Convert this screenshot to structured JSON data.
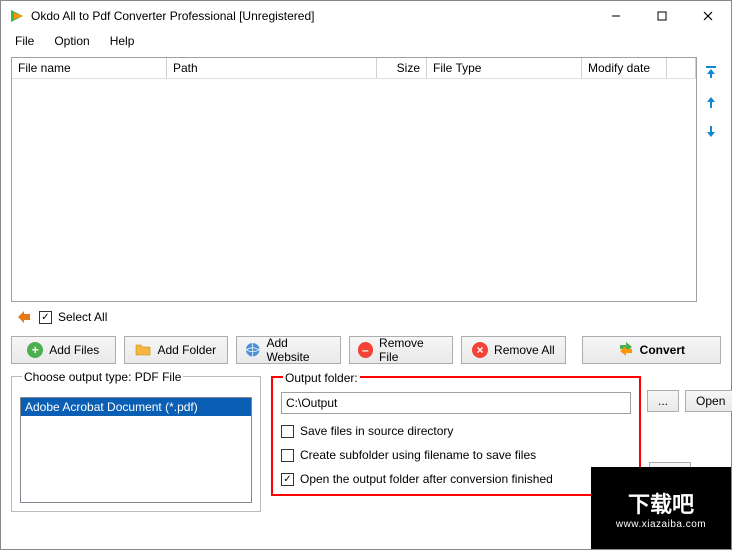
{
  "window": {
    "title": "Okdo All to Pdf Converter Professional [Unregistered]"
  },
  "menu": {
    "file": "File",
    "option": "Option",
    "help": "Help"
  },
  "table": {
    "cols": {
      "filename": "File name",
      "path": "Path",
      "size": "Size",
      "filetype": "File Type",
      "modify": "Modify date"
    }
  },
  "selectAll": {
    "label": "Select All",
    "checked": "✓"
  },
  "buttons": {
    "addFiles": "Add Files",
    "addFolder": "Add Folder",
    "addWebsite": "Add Website",
    "removeFile": "Remove File",
    "removeAll": "Remove All",
    "convert": "Convert"
  },
  "outputType": {
    "legend": "Choose output type:  PDF File",
    "item": "Adobe Acrobat Document (*.pdf)"
  },
  "outputFolder": {
    "legend": "Output folder:",
    "value": "C:\\Output",
    "browse": "...",
    "open": "Open",
    "opt1": "Save files in source directory",
    "opt2": "Create subfolder using filename to save files",
    "opt3": "Open the output folder after conversion finished"
  },
  "watermark": {
    "big": "下载吧",
    "small": "www.xiazaiba.com"
  }
}
